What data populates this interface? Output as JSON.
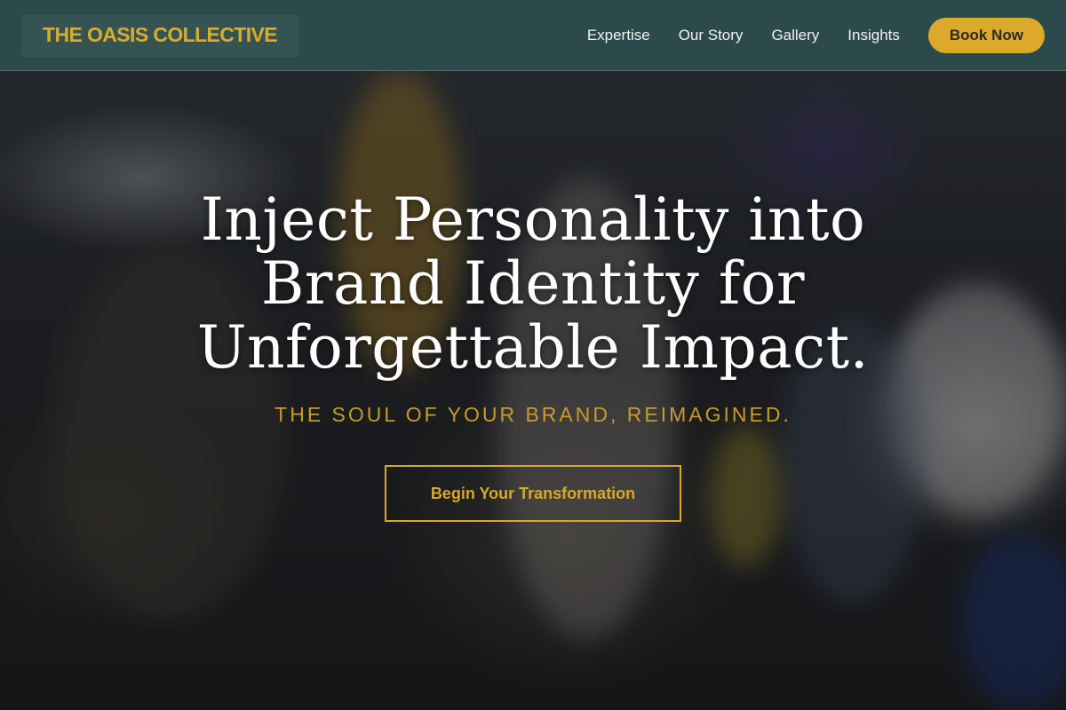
{
  "header": {
    "logo_text": "THE OASIS COLLECTIVE",
    "nav": [
      {
        "label": "Expertise"
      },
      {
        "label": "Our Story"
      },
      {
        "label": "Gallery"
      },
      {
        "label": "Insights"
      }
    ],
    "book_label": "Book Now"
  },
  "hero": {
    "headline_line1": "Inject Personality into",
    "headline_line2": "Brand Identity for",
    "headline_line3": "Unforgettable Impact.",
    "tagline": "THE SOUL OF YOUR BRAND, REIMAGINED.",
    "cta_label": "Begin Your Transformation"
  },
  "colors": {
    "header_bg": "#2c4a4b",
    "accent_gold": "#dca92a",
    "headline_text": "#ffffff"
  }
}
